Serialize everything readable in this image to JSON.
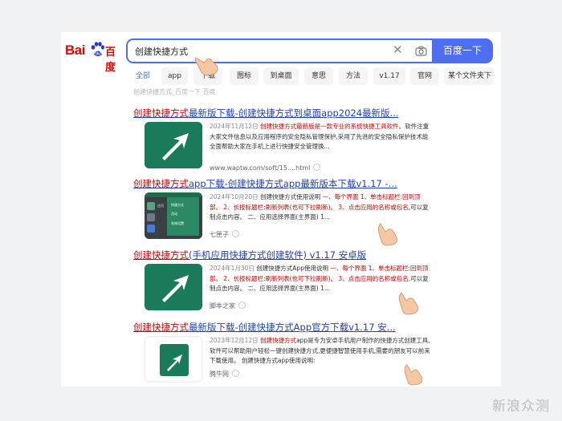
{
  "logo": {
    "bai": "Bai",
    "du": "百度"
  },
  "search": {
    "query": "创建快捷方式",
    "button_label": "百度一下"
  },
  "tabs": [
    {
      "label": "全部"
    },
    {
      "label": "app"
    },
    {
      "label": "下载"
    },
    {
      "label": "图标"
    },
    {
      "label": "到桌面"
    },
    {
      "label": "意思"
    },
    {
      "label": "方法"
    },
    {
      "label": "v1.17"
    },
    {
      "label": "官网"
    },
    {
      "label": "某个文件夹下"
    }
  ],
  "faded_line": "创建快捷方式_百度一下 百度",
  "results": [
    {
      "title_hl": "创建快捷方式",
      "title_rest": "最新版下载-创建快捷方式到桌面app2024最新版...",
      "date": "2024年11月12日",
      "snippet_red": "创建快捷方式最新版是一款专业的系统快捷工具软件。",
      "snippet_rest": "软件注重大家文件信息以及应用程序的安全隐私管理保护,采用了先进的安全隐私保护技术能全面帮助大家在手机上进行快捷安全管理换...",
      "source": "www.waptw.com/soft/15....html"
    },
    {
      "title_hl": "创建快捷方式",
      "title_rest": "app下载-创建快捷方式app最新版本下载v1.17 -...",
      "date": "2024年10月20日",
      "snippet_plain": "创建快捷方式使用说明",
      "snippet_red": "一、每个界面 1、单击标题栏:回到顶部。 2、长按标题栏:刷新列表(也可下拉刷新)。 3、点击应用的名称或包名",
      "snippet_rest": ",可以复制点击内容。 二、应用选择界面(主界面) 1...",
      "source": "七匣子"
    },
    {
      "title_hl": "创建快捷方式",
      "title_rest": "(手机应用快捷方式创建软件) v1.17 安卓版",
      "date": "2024年1月30日",
      "snippet_plain": "创建快捷方式App使用说明",
      "snippet_red": "一、每个界面 1、单击标题栏:回到顶部。 2、长按标题栏:刷新列表(也可下拉刷新)。 3、点击应用的名称或包名",
      "snippet_rest": ",可以复制点击内容。 二、应用选择界面(主界面) 1...",
      "source": "脚本之家"
    },
    {
      "title_hl": "创建快捷方式",
      "title_rest": "最新版下载-创建快捷方式App官方下载v1.17 安...",
      "date": "2023年12月12日",
      "snippet_red": "创建快捷方式",
      "snippet_rest": "app是专为安卓手机用户制作的快捷方式创建工具,软件可以帮助用户轻松一键创建快捷方式,更便捷智慧使用手机,需要的朋友可以前来下载使用。 创建快捷方式app使用说明:",
      "source": "腾牛网"
    }
  ],
  "thumb_phone_texts": [
    "应用",
    "快捷方式",
    "活动",
    "系统设置"
  ],
  "watermark": "新浪众测",
  "colors": {
    "accent": "#4e6ef2",
    "title_link": "#2440b3",
    "highlight": "#c00000",
    "thumb_green": "#1a7a5a"
  }
}
